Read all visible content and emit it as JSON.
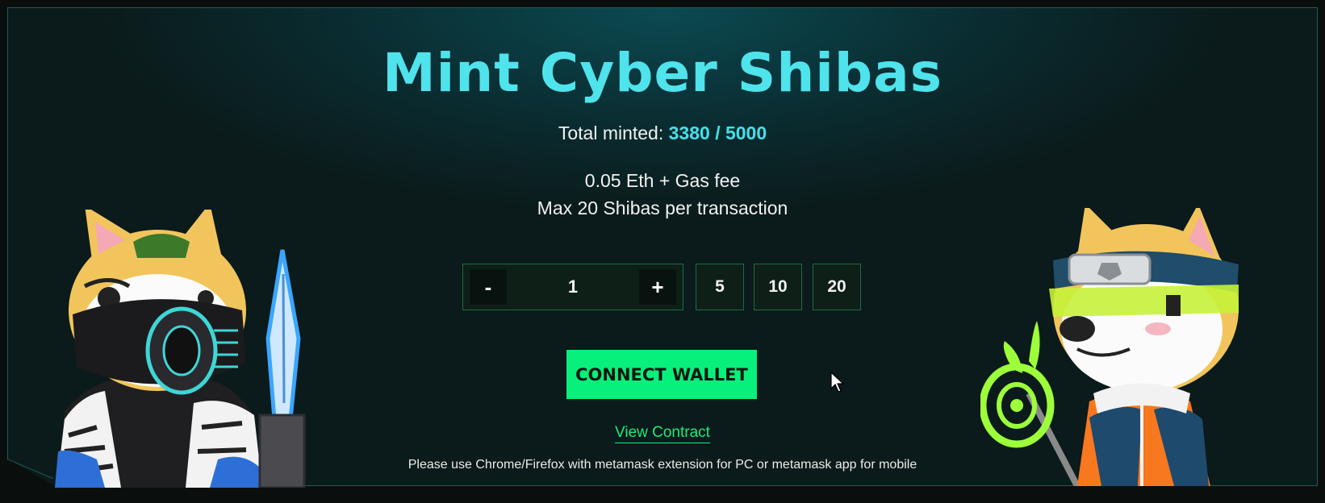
{
  "mint": {
    "title": "Mint Cyber Shibas",
    "minted_label": "Total minted:",
    "minted_count": "3380 / 5000",
    "price": "0.05 Eth + Gas fee",
    "max_per_tx": "Max 20 Shibas per transaction"
  },
  "quantity": {
    "minus": "-",
    "value": "1",
    "plus": "+",
    "presets": [
      "5",
      "10",
      "20"
    ]
  },
  "actions": {
    "connect_wallet": "CONNECT WALLET",
    "view_contract": "View Contract",
    "note": "Please use Chrome/Firefox with metamask extension for PC or metamask app for mobile"
  },
  "colors": {
    "title": "#4fe3ec",
    "accent_green": "#07f07b",
    "border_green": "#1f6b45"
  },
  "icons": {
    "left_art": "cyber-shiba-mask-knife",
    "right_art": "cyber-shiba-headband-staff",
    "cursor": "mouse-pointer-icon"
  }
}
